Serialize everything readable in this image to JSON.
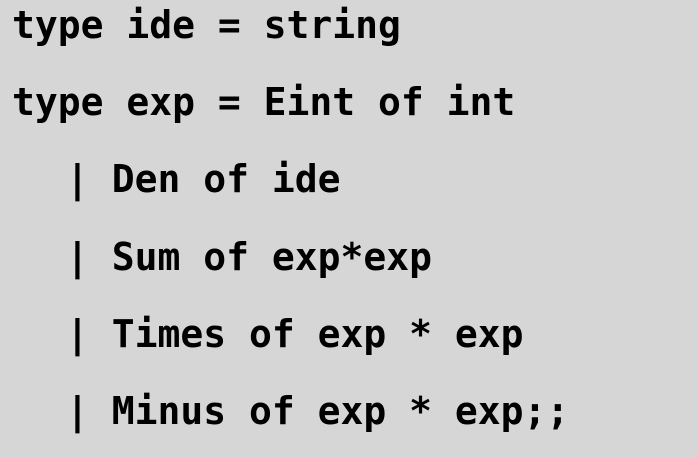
{
  "code": {
    "lines": [
      "type ide = string",
      "type exp = Eint of int",
      "| Den of ide",
      "| Sum of exp*exp",
      "| Times of exp * exp",
      "| Minus of exp * exp;;"
    ]
  }
}
